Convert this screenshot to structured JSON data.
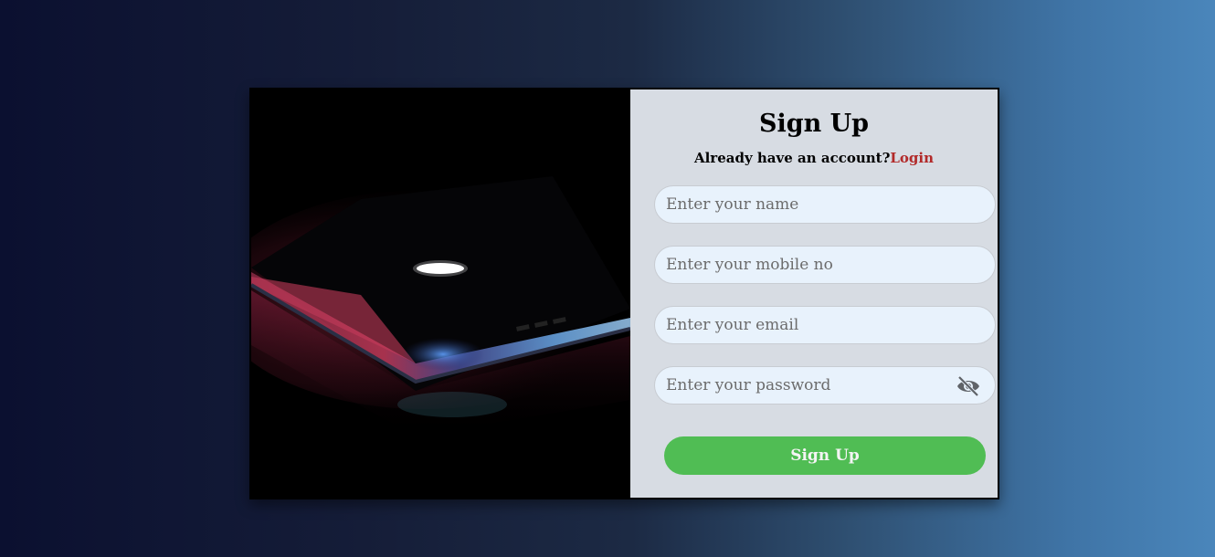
{
  "form": {
    "title": "Sign Up",
    "subtitle_prefix": "Already have an account?",
    "login_link": "Login",
    "fields": [
      {
        "placeholder": "Enter your name",
        "value": ""
      },
      {
        "placeholder": "Enter your mobile no",
        "value": ""
      },
      {
        "placeholder": "Enter your email",
        "value": ""
      },
      {
        "placeholder": "Enter your password",
        "value": ""
      }
    ],
    "password_toggle_icon": "eye-slash-icon",
    "submit_label": "Sign Up"
  },
  "image": {
    "subject": "laptop-photo"
  },
  "colors": {
    "link": "#b22a2a",
    "button": "#50bd54",
    "input_bg": "#e8f2fc",
    "panel_bg": "#d7dce3"
  }
}
